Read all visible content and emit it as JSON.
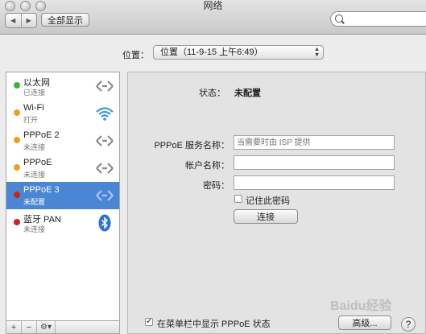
{
  "window": {
    "title": "网络"
  },
  "toolbar": {
    "back_glyph": "◀",
    "forward_glyph": "▶",
    "show_all_label": "全部显示",
    "search_placeholder": ""
  },
  "location": {
    "label": "位置：",
    "value": "位置（11-9-15 上午6:49）"
  },
  "services": [
    {
      "name": "以太网",
      "status": "已连接",
      "dot_color": "#3cb43c",
      "icon": "ethernet-icon"
    },
    {
      "name": "Wi-Fi",
      "status": "打开",
      "dot_color": "#f0a020",
      "icon": "wifi-icon"
    },
    {
      "name": "PPPoE 2",
      "status": "未连接",
      "dot_color": "#f0a020",
      "icon": "ethernet-icon"
    },
    {
      "name": "PPPoE",
      "status": "未连接",
      "dot_color": "#f0a020",
      "icon": "ethernet-icon"
    },
    {
      "name": "PPPoE 3",
      "status": "未配置",
      "dot_color": "#d02020",
      "icon": "ethernet-icon",
      "selected": true
    },
    {
      "name": "蓝牙 PAN",
      "status": "未连接",
      "dot_color": "#d02020",
      "icon": "bluetooth-icon"
    }
  ],
  "sidebar_controls": {
    "add": "+",
    "remove": "−",
    "action": "⚙▾"
  },
  "detail": {
    "status_label": "状态：",
    "status_value": "未配置",
    "service_name_label": "PPPoE 服务名称：",
    "service_name_placeholder": "当需要时由 ISP 提供",
    "account_label": "帐户名称：",
    "password_label": "密码：",
    "remember_password_label": "记住此密码",
    "connect_button": "连接",
    "show_in_menubar_label": "在菜单栏中显示 PPPoE 状态",
    "advanced_button": "高级...",
    "help_button": "?"
  },
  "colors": {
    "selection": "#4b86d4"
  },
  "watermark": "Baidu经验"
}
